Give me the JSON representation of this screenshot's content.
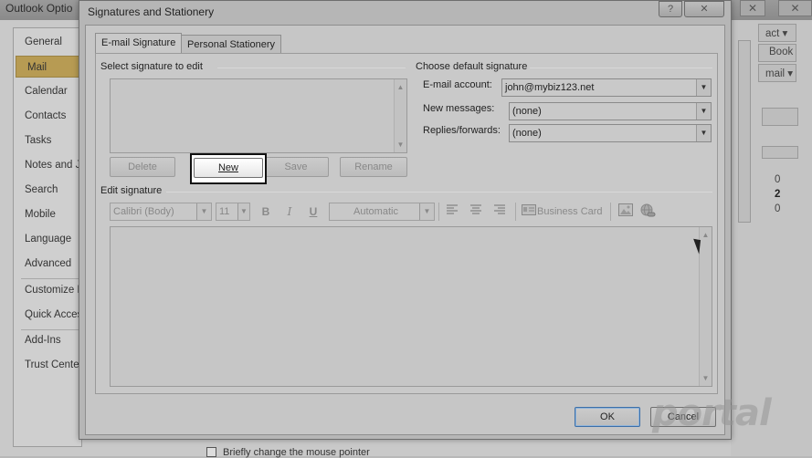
{
  "background_window": {
    "title": "Outlook Optio",
    "close_glyph": "✕",
    "nav": [
      "General",
      "Mail",
      "Calendar",
      "Contacts",
      "Tasks",
      "Notes and Jo",
      "Search",
      "Mobile",
      "Language",
      "Advanced",
      "Customize R",
      "Quick Acces",
      "Add-Ins",
      "Trust Cente"
    ],
    "selected_nav": "Mail",
    "right_pane": {
      "text_act": "act ▾",
      "text_book": "Book",
      "text_mail": "mail ▾",
      "num_0a": "0",
      "num_2": "2",
      "num_0b": "0"
    },
    "bottom_text": "Briefly change the mouse pointer"
  },
  "dialog": {
    "title": "Signatures and Stationery",
    "help_glyph": "?",
    "close_glyph": "✕",
    "tabs": [
      {
        "label": "E-mail Signature",
        "active": true
      },
      {
        "label": "Personal Stationery",
        "active": false
      }
    ],
    "select_signature_label": "Select signature to edit",
    "buttons": {
      "delete": "Delete",
      "new": "New",
      "save": "Save",
      "rename": "Rename",
      "ok": "OK",
      "cancel": "Cancel"
    },
    "default_signature": {
      "group_label": "Choose default signature",
      "email_account_label": "E-mail account:",
      "email_account_value": "john@mybiz123.net",
      "new_messages_label": "New messages:",
      "new_messages_value": "(none)",
      "replies_label": "Replies/forwards:",
      "replies_value": "(none)"
    },
    "edit_signature": {
      "group_label": "Edit signature",
      "font": "Calibri (Body)",
      "size": "11",
      "bold": "B",
      "italic": "I",
      "underline": "U",
      "color": "Automatic",
      "business_card": "Business Card"
    }
  },
  "watermark": "portal"
}
